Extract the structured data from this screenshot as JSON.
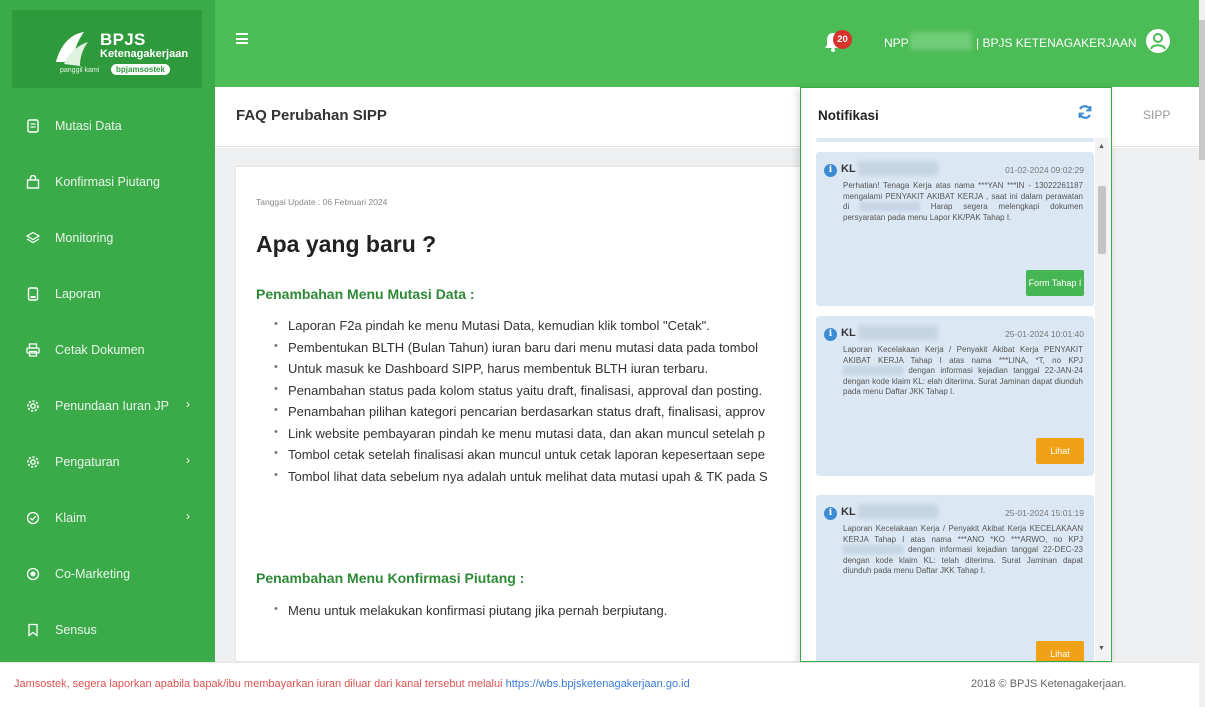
{
  "brand": {
    "title": "BPJS",
    "subtitle": "Ketenagakerjaan",
    "tagline": "panggil kami",
    "pill": "bpjamsostek"
  },
  "sidebar": {
    "items": [
      {
        "label": "Mutasi Data",
        "icon": "document-icon"
      },
      {
        "label": "Konfirmasi Piutang",
        "icon": "bag-icon"
      },
      {
        "label": "Monitoring",
        "icon": "layers-icon"
      },
      {
        "label": "Laporan",
        "icon": "file-icon"
      },
      {
        "label": "Cetak Dokumen",
        "icon": "printer-icon"
      },
      {
        "label": "Penundaan Iuran JP",
        "icon": "gear-icon",
        "arrow": "›"
      },
      {
        "label": "Pengaturan",
        "icon": "gear-icon",
        "arrow": "›"
      },
      {
        "label": "Klaim",
        "icon": "check-circle-icon",
        "arrow": "›"
      },
      {
        "label": "Co-Marketing",
        "icon": "target-icon"
      },
      {
        "label": "Sensus",
        "icon": "bookmark-icon"
      }
    ]
  },
  "header": {
    "badge_count": "20",
    "npp_label": "NPP :",
    "org_label": "| BPJS KETENAGAKERJAAN"
  },
  "page": {
    "title": "FAQ Perubahan SIPP",
    "breadcrumb": "SIPP",
    "update_date": "Tanggal Update : 06 Februari 2024",
    "heading": "Apa yang baru ?",
    "section1_title": "Penambahan Menu Mutasi Data :",
    "section1_items": [
      "Laporan F2a pindah ke menu Mutasi Data, kemudian klik tombol \"Cetak\".",
      "Pembentukan BLTH (Bulan Tahun) iuran baru dari menu mutasi data pada tombol",
      "Untuk masuk ke Dashboard SIPP, harus membentuk BLTH iuran terbaru.",
      "Penambahan status pada kolom status yaitu draft, finalisasi, approval dan posting.",
      "Penambahan pilihan kategori pencarian berdasarkan status draft, finalisasi, approv",
      "Link website pembayaran pindah ke menu mutasi data, dan akan muncul setelah p",
      "Tombol cetak setelah finalisasi akan muncul untuk cetak laporan kepesertaan sepe",
      "Tombol lihat data sebelum nya adalah untuk melihat data mutasi upah & TK pada S"
    ],
    "section2_title": "Penambahan Menu Konfirmasi Piutang :",
    "section2_items": [
      "Menu untuk melakukan konfirmasi piutang jika pernah berpiutang."
    ]
  },
  "notifications": {
    "title": "Notifikasi",
    "items": [
      {
        "code": "KL",
        "date": "01-02-2024 09:02:29",
        "body_pre": "Perhatian! Tenaga Kerja atas nama ***YAN ***IN - 13022261187 mengalami PENYAKIT AKIBAT KERJA , saat ini dalam perawatan di",
        "body_post": "Harap segera melengkapi dokumen persyaratan pada menu Lapor KK/PAK Tahap I.",
        "button": "Form Tahap I"
      },
      {
        "code": "KL",
        "date": "25-01-2024 10:01:40",
        "body_pre": "Laporan Kecelakaan Kerja / Penyakit Akibat Kerja PENYAKIT AKIBAT KERJA Tahap I atas nama ***LINA, *T, no KPJ",
        "body_post": "dengan informasi kejadian tanggal 22-JAN-24 dengan kode klaim KL: elah diterima. Surat Jaminan dapat diunduh pada menu Daftar JKK Tahap I.",
        "button": "Lihat"
      },
      {
        "code": "KL",
        "date": "25-01-2024 15:01:19",
        "body_pre": "Laporan Kecelakaan Kerja / Penyakit Akibat Kerja KECELAKAAN KERJA Tahap I atas nama ***ANO *KO ***ARWO, no KPJ",
        "body_post": "dengan informasi kejadian tanggal 22-DEC-23 dengan kode klaim KL: telah diterima. Surat Jaminan dapat diunduh pada menu Daftar JKK Tahap I.",
        "button": "Lihat"
      }
    ]
  },
  "footer": {
    "note": "Jamsostek, segera laporkan apabila bapak/ibu membayarkan iuran diluar dari kanal tersebut melalui",
    "link": "https://wbs.bpjsketenagakerjaan.go.id",
    "copyright": "2018 © BPJS Ketenagakerjaan."
  },
  "colors": {
    "sidebar": "#3aab48",
    "topbar": "#4cbc56",
    "accent_green": "#2e8a37",
    "badge": "#d9322c",
    "notif_card": "#dbe8f4",
    "button_orange": "#f0a116"
  }
}
